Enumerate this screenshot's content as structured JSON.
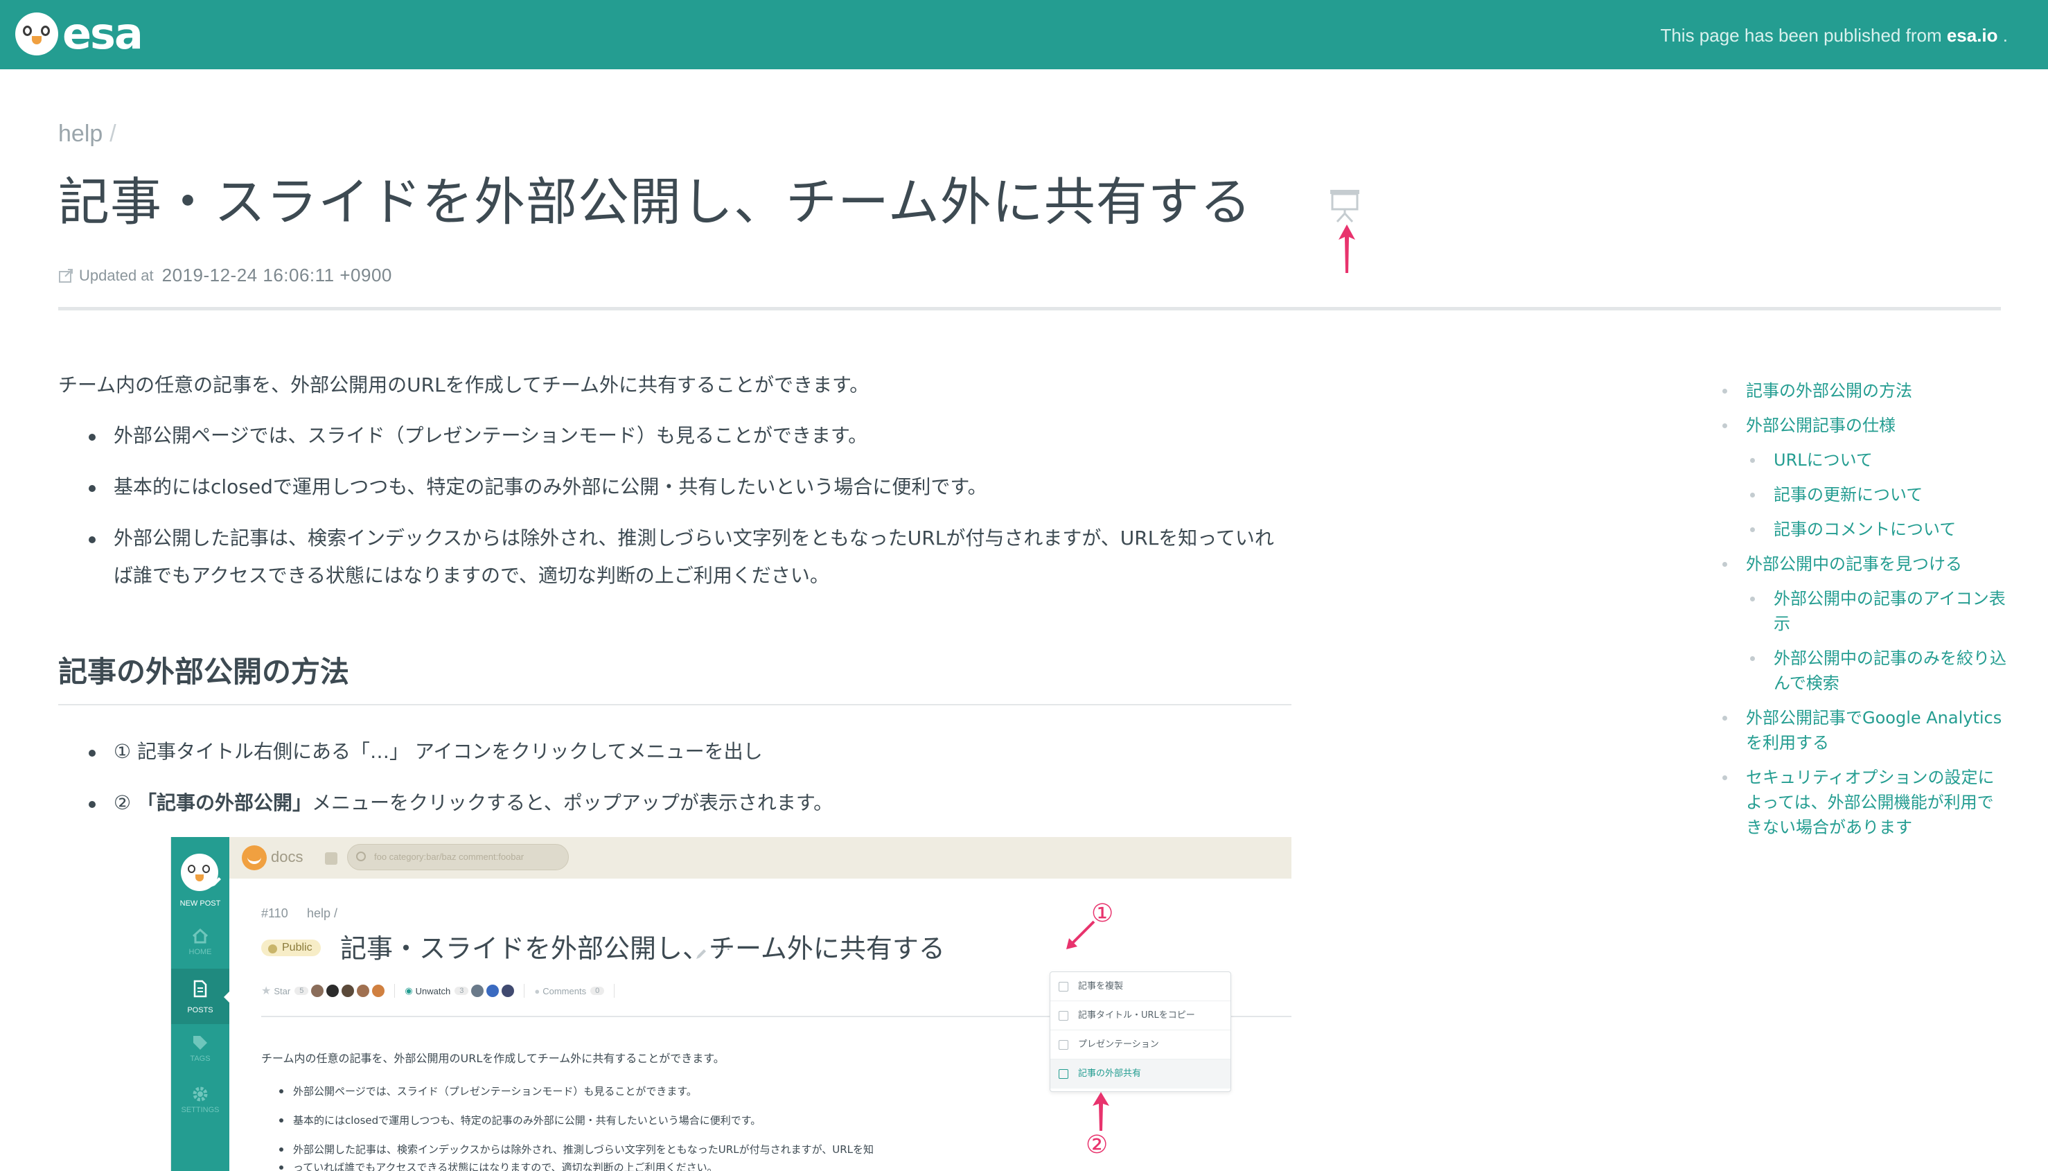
{
  "header": {
    "logo_text": "esa",
    "published_prefix": "This page has been published from ",
    "published_site": "esa.io",
    "published_suffix": " .",
    "bg_color": "#249d91"
  },
  "post": {
    "category": "help",
    "breadcrumb_sep": "/",
    "title": "記事・スライドを外部公開し、チーム外に共有する",
    "updated_label": "Updated at",
    "updated_at": "2019-12-24 16:06:11 +0900",
    "slide_icon": "presentation-icon"
  },
  "body": {
    "intro": "チーム内の任意の記事を、外部公開用のURLを作成してチーム外に共有することができます。",
    "bullets": [
      "外部公開ページでは、スライド（プレゼンテーションモード）も見ることができます。",
      "基本的にはclosedで運用しつつも、特定の記事のみ外部に公開・共有したいという場合に便利です。",
      "外部公開した記事は、検索インデックスからは除外され、推測しづらい文字列をともなったURLが付与されますが、URLを知っていれば誰でもアクセスできる状態にはなりますので、適切な判断の上ご利用ください。"
    ],
    "section_heading": "記事の外部公開の方法",
    "steps": [
      {
        "pre": "① 記事タイトル右側にある「…」 アイコンをクリックしてメニューを出し",
        "bold": "",
        "post": ""
      },
      {
        "pre": "② ",
        "bold": "「記事の外部公開」",
        "post": "メニューをクリックすると、ポップアップが表示されます。"
      }
    ]
  },
  "toc": [
    {
      "level": 1,
      "label": "記事の外部公開の方法"
    },
    {
      "level": 1,
      "label": "外部公開記事の仕様"
    },
    {
      "level": 2,
      "label": "URLについて"
    },
    {
      "level": 2,
      "label": "記事の更新について"
    },
    {
      "level": 2,
      "label": "記事のコメントについて"
    },
    {
      "level": 1,
      "label": "外部公開中の記事を見つける"
    },
    {
      "level": 2,
      "label": "外部公開中の記事のアイコン表示"
    },
    {
      "level": 2,
      "label": "外部公開中の記事のみを絞り込んで検索"
    },
    {
      "level": 1,
      "label": "外部公開記事でGoogle Analyticsを利用する"
    },
    {
      "level": 1,
      "label": "セキュリティオプションの設定によっては、外部公開機能が利用できない場合があります"
    }
  ],
  "screenshot": {
    "sidebar": {
      "new_post": "NEW POST",
      "home": "HOME",
      "posts": "POSTS",
      "tags": "TAGS",
      "settings": "SETTINGS"
    },
    "team": "docs",
    "search_placeholder": "foo category:bar/baz comment:foobar",
    "post_number": "#110",
    "category": "help /",
    "public_badge": "Public",
    "title": "記事・スライドを外部公開し、チーム外に共有する",
    "dots": "···",
    "star_label": "Star",
    "star_count": "5",
    "unwatch_label": "Unwatch",
    "unwatch_count": "3",
    "comments_label": "Comments",
    "comments_count": "0",
    "intro": "チーム内の任意の記事を、外部公開用のURLを作成してチーム外に共有することができます。",
    "bullets": [
      "外部公開ページでは、スライド（プレゼンテーションモード）も見ることができます。",
      "基本的にはclosedで運用しつつも、特定の記事のみ外部に公開・共有したいという場合に便利です。",
      "外部公開した記事は、検索インデックスからは除外され、推測しづらい文字列をともなったURLが付与されますが、URLを知",
      "っていれば誰でもアクセスできる状態にはなりますので、適切な判断の上ご利用ください。"
    ],
    "menu": [
      "記事を複製",
      "記事タイトル・URLをコピー",
      "プレゼンテーション",
      "記事の外部共有"
    ],
    "annotation_1": "①",
    "annotation_2": "②",
    "accent_color": "#e8336d"
  }
}
